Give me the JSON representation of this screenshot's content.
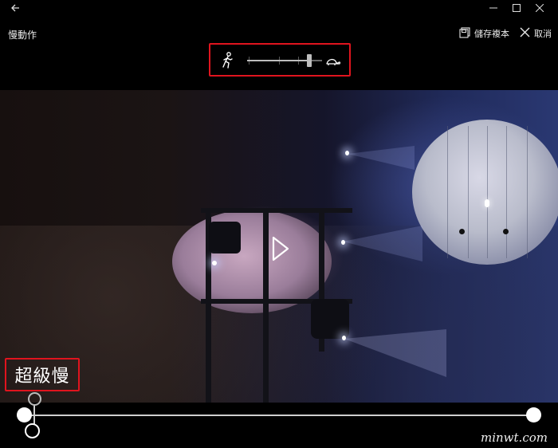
{
  "titlebar": {
    "back_icon": "back-arrow-icon",
    "minimize_icon": "minimize-icon",
    "maximize_icon": "maximize-icon",
    "close_icon": "close-icon"
  },
  "app": {
    "title": "慢動作"
  },
  "commands": {
    "save_copy_label": "儲存複本",
    "save_copy_icon": "save-copy-icon",
    "cancel_label": "取消",
    "cancel_icon": "close-x-icon"
  },
  "speed_slider": {
    "fast_icon": "walking-person-icon",
    "slow_icon": "turtle-icon",
    "value_fraction": 0.83,
    "accent_color": "#e0141e"
  },
  "video": {
    "play_icon": "play-icon"
  },
  "annotation": {
    "label": "超級慢"
  },
  "timeline": {
    "start_handle": "trim-start-handle",
    "end_handle": "trim-end-handle"
  },
  "watermark": {
    "text": "minwt.com"
  }
}
